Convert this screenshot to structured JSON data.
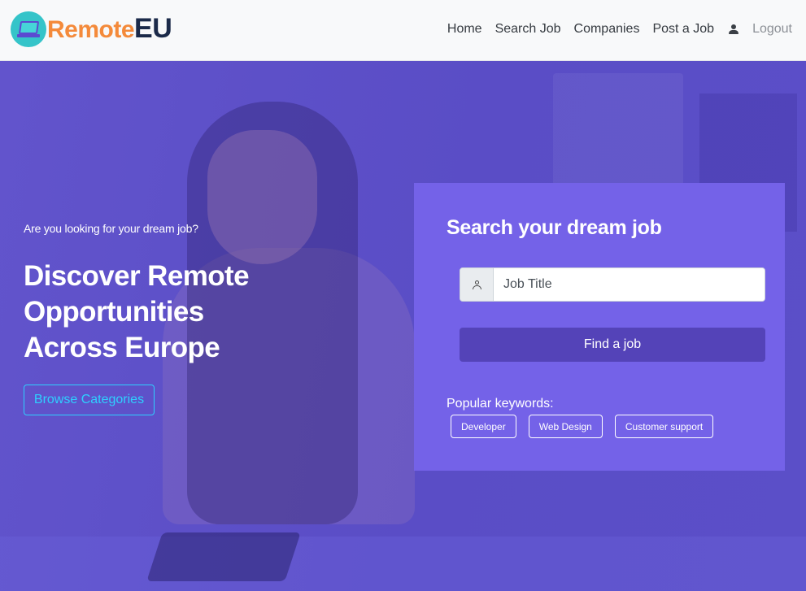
{
  "brand": {
    "name_part1": "Remote",
    "name_part2": "EU"
  },
  "nav": {
    "items": [
      {
        "label": "Home"
      },
      {
        "label": "Search Job"
      },
      {
        "label": "Companies"
      },
      {
        "label": "Post a Job"
      }
    ],
    "logout_label": "Logout"
  },
  "hero": {
    "tagline": "Are you looking for your dream job?",
    "headline": "Discover Remote Opportunities Across Europe",
    "browse_label": "Browse Categories"
  },
  "search": {
    "title": "Search your dream job",
    "placeholder": "Job Title",
    "button_label": "Find a job",
    "popular_label": "Popular keywords:",
    "keywords": [
      {
        "label": "Developer"
      },
      {
        "label": "Web Design"
      },
      {
        "label": "Customer support"
      }
    ]
  },
  "colors": {
    "brand_orange": "#f48a3a",
    "brand_navy": "#1b2a49",
    "accent_cyan": "#2ed0ff",
    "panel_purple": "#7462e8",
    "button_purple": "#5443b8"
  },
  "icons": {
    "logo": "laptop-icon",
    "user": "user-icon",
    "input_addon": "person-icon"
  }
}
